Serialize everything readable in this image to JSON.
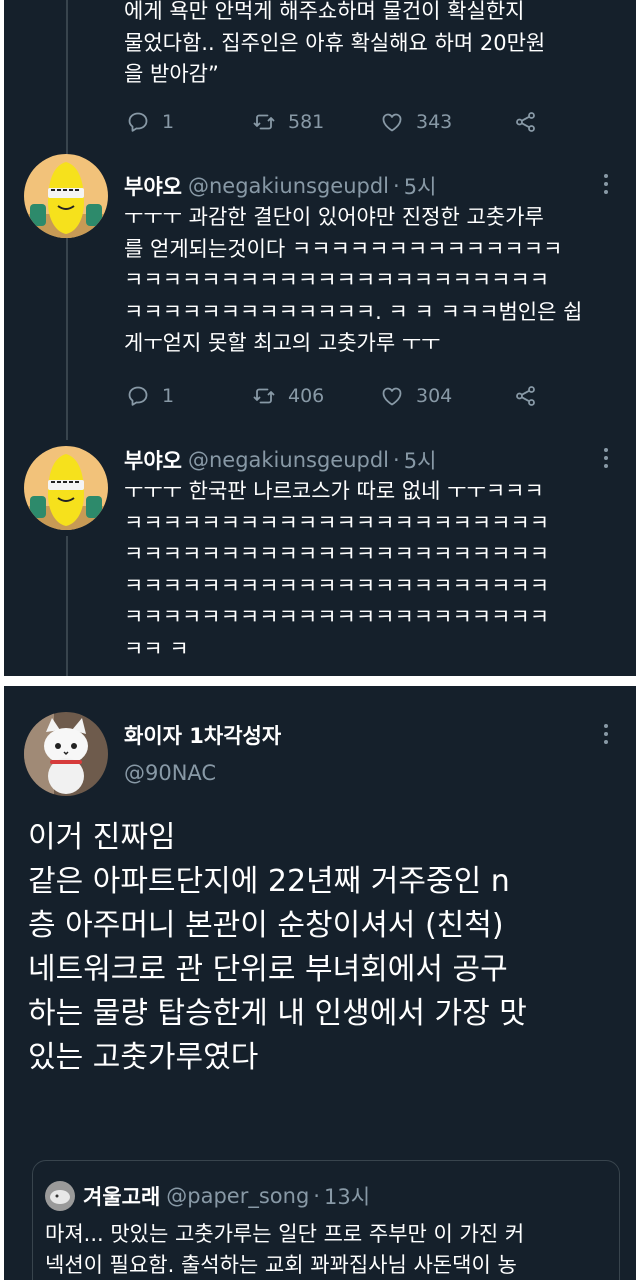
{
  "colors": {
    "background": "#15202b",
    "text": "#ffffff",
    "muted": "#8899a6",
    "border": "#38444d"
  },
  "tweet0": {
    "text": "에게 욕만 안먹게 해주쇼하며 물건이 확실한지\n물었다함.. 집주인은 아휴 확실해요 하며 20만원\n을 받아감”",
    "actions": {
      "reply": "1",
      "retweet": "581",
      "like": "343"
    }
  },
  "tweet1": {
    "name": "부야오",
    "handle": "@negakiunsgeupdl",
    "separator": "·",
    "time": "5시",
    "text": "ㅜㅜㅜ 과감한 결단이 있어야만 진정한 고춧가루\n를 얻게되는것이다 ㅋㅋㅋㅋㅋㅋㅋㅋㅋㅋㅋㅋㅋㅋ\nㅋㅋㅋㅋㅋㅋㅋㅋㅋㅋㅋㅋㅋㅋㅋㅋㅋㅋㅋㅋㅋㅋ\nㅋㅋㅋㅋㅋㅋㅋㅋㅋㅋㅋㅋㅋ. ㅋ ㅋ ㅋㅋㅋ범인은 쉽\n게ㅜ얻지 못할 최고의 고춧가루 ㅜㅜ",
    "actions": {
      "reply": "1",
      "retweet": "406",
      "like": "304"
    }
  },
  "tweet2": {
    "name": "부야오",
    "handle": "@negakiunsgeupdl",
    "separator": "·",
    "time": "5시",
    "text": "ㅜㅜㅜ 한국판 나르코스가 따로 없네 ㅜㅜㅋㅋㅋ\nㅋㅋㅋㅋㅋㅋㅋㅋㅋㅋㅋㅋㅋㅋㅋㅋㅋㅋㅋㅋㅋㅋ\nㅋㅋㅋㅋㅋㅋㅋㅋㅋㅋㅋㅋㅋㅋㅋㅋㅋㅋㅋㅋㅋㅋ\nㅋㅋㅋㅋㅋㅋㅋㅋㅋㅋㅋㅋㅋㅋㅋㅋㅋㅋㅋㅋㅋㅋ\nㅋㅋㅋㅋㅋㅋㅋㅋㅋㅋㅋㅋㅋㅋㅋㅋㅋㅋㅋㅋㅋㅋ\nㅋㅋ ㅋ"
  },
  "main_tweet": {
    "name": "화이자 1차각성자",
    "handle": "@90NAC",
    "text": "이거 진짜임\n같은 아파트단지에 22년째 거주중인 n\n층 아주머니 본관이 순창이셔서 (친척)\n네트워크로 관 단위로 부녀회에서 공구\n하는 물량 탑승한게 내 인생에서 가장 맛\n있는 고춧가루였다",
    "quote": {
      "name": "겨울고래",
      "handle": "@paper_song",
      "separator": "·",
      "time": "13시",
      "text": "마져... 맛있는 고춧가루는 일단 프로 주부만 이 가진 커\n넥션이 필요함. 출석하는 교회 꽈꽈집사님 사돈댁이 농"
    }
  }
}
